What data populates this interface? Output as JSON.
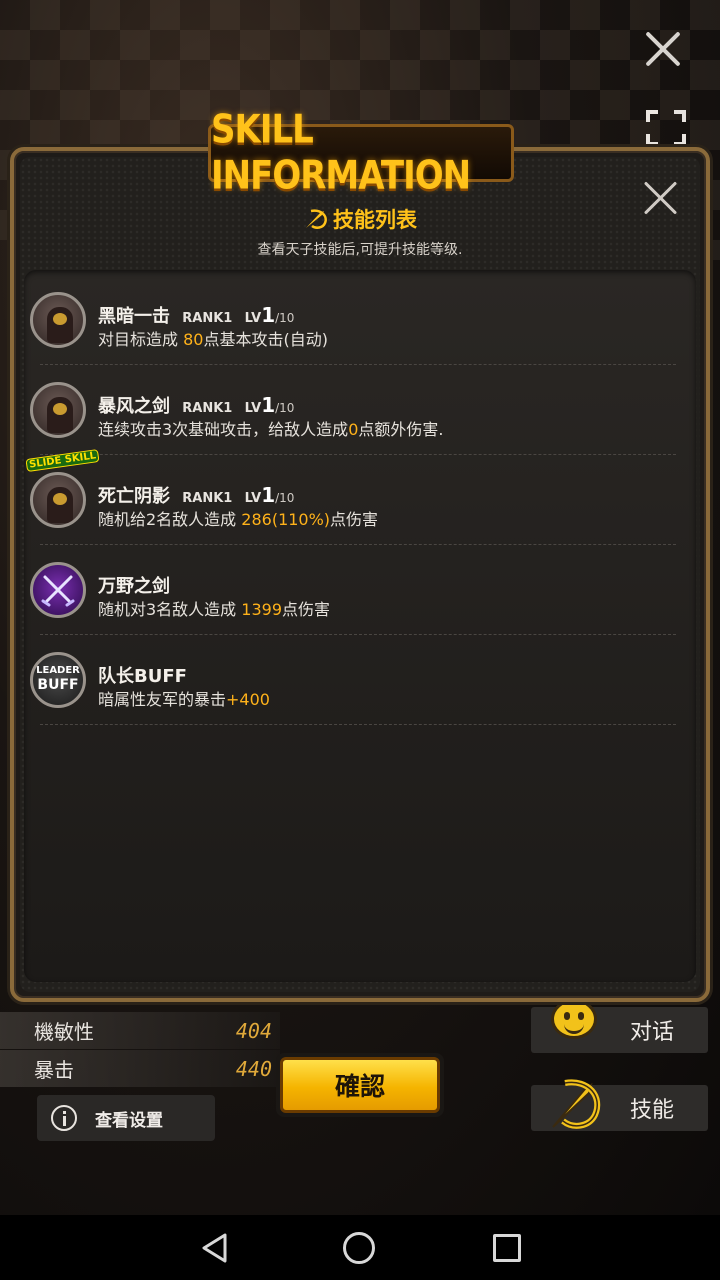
{
  "title_banner": "SKILL INFORMATION",
  "list_heading": "技能列表",
  "list_subtitle": "查看天子技能后,可提升技能等级.",
  "skills": [
    {
      "name": "黑暗一击",
      "rank": "RANK1",
      "lv": "LV",
      "lv_cur": "1",
      "lv_max": "/10",
      "desc_pre": "对目标造成 ",
      "desc_hl": "80",
      "desc_post": "点基本攻击(自动)",
      "icon": "dark-figure-icon"
    },
    {
      "name": "暴风之剑",
      "rank": "RANK1",
      "lv": "LV",
      "lv_cur": "1",
      "lv_max": "/10",
      "desc_pre": "连续攻击3次基础攻击，给敌人造成",
      "desc_hl": "0",
      "desc_post": "点额外伤害.",
      "icon": "dark-figure-icon"
    },
    {
      "name": "死亡阴影",
      "rank": "RANK1",
      "lv": "LV",
      "lv_cur": "1",
      "lv_max": "/10",
      "desc_pre": "随机给2名敌人造成 ",
      "desc_hl": "286(110%)",
      "desc_post": "点伤害",
      "icon": "dark-figure-icon",
      "badge": "SLIDE SKILL"
    },
    {
      "name": "万野之剑",
      "rank": "",
      "lv": "",
      "lv_cur": "",
      "lv_max": "",
      "desc_pre": "随机对3名敌人造成 ",
      "desc_hl": "1399",
      "desc_post": "点伤害",
      "icon": "crossed-swords-icon"
    },
    {
      "name": "队长BUFF",
      "rank": "",
      "lv": "",
      "lv_cur": "",
      "lv_max": "",
      "desc_pre": "暗属性友军的暴击",
      "desc_hl": "+400",
      "desc_post": "",
      "icon": "leader-buff-icon",
      "icon_text_top": "LEADER",
      "icon_text_bottom": "BUFF"
    }
  ],
  "stats": [
    {
      "label": "機敏性",
      "value": "404"
    },
    {
      "label": "暴击",
      "value": "440"
    }
  ],
  "view_settings_label": "查看设置",
  "confirm_label": "確認",
  "talk_label": "对话",
  "skill_label": "技能",
  "colors": {
    "accent": "#ffc21a",
    "highlight": "#ffb21a",
    "button": "#f5b400"
  }
}
